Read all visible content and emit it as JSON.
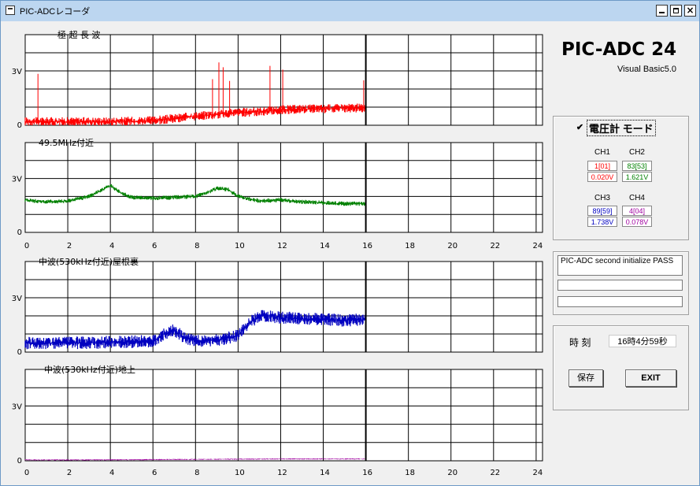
{
  "window": {
    "title": "PIC-ADCレコーダ"
  },
  "app": {
    "name": "PIC-ADC 24",
    "subtitle": "Visual Basic5.0"
  },
  "mode": {
    "label": "電圧計 モード",
    "checked": true,
    "check_glyph": "✔"
  },
  "channels": [
    {
      "label": "CH1",
      "raw": "1[01]",
      "voltage": "0.020V",
      "color": "#ff0000"
    },
    {
      "label": "CH2",
      "raw": "83[53]",
      "voltage": "1.621V",
      "color": "#008000"
    },
    {
      "label": "CH3",
      "raw": "89[59]",
      "voltage": "1.738V",
      "color": "#0000c0"
    },
    {
      "label": "CH4",
      "raw": "4[04]",
      "voltage": "0.078V",
      "color": "#a000a0"
    }
  ],
  "status_lines": [
    "PIC-ADC second initialize PASS",
    "",
    ""
  ],
  "clock": {
    "label": "時 刻",
    "value": "16時4分59秒"
  },
  "buttons": {
    "save": "保存",
    "exit": "EXIT"
  },
  "chart_data": [
    {
      "type": "line",
      "title": "極 超 長 波",
      "ytick_labels": [
        "3V",
        "0"
      ],
      "x_tick_labels": [],
      "xlim": [
        0,
        24.3
      ],
      "ylim": [
        0,
        5
      ],
      "cursor_x": 16,
      "color": "#ff0000",
      "series": [
        {
          "x": [
            0,
            2,
            4,
            6,
            8,
            9,
            10,
            11,
            12,
            13,
            14,
            15,
            16
          ],
          "values": [
            0.2,
            0.2,
            0.2,
            0.25,
            0.5,
            0.6,
            0.7,
            0.75,
            0.85,
            0.9,
            0.9,
            0.95,
            0.95
          ]
        }
      ]
    },
    {
      "type": "line",
      "title": "49.5MHz付近",
      "ytick_labels": [
        "3V",
        "0"
      ],
      "x_tick_labels": [
        "0",
        "2",
        "4",
        "6",
        "8",
        "10",
        "12",
        "14",
        "16",
        "18",
        "20",
        "22",
        "24"
      ],
      "xlim": [
        0,
        24.3
      ],
      "ylim": [
        0,
        5
      ],
      "cursor_x": 16,
      "color": "#008000",
      "series": [
        {
          "x": [
            0,
            1,
            2,
            3,
            3.5,
            4,
            4.5,
            5,
            6,
            7,
            8,
            8.5,
            9,
            9.5,
            10,
            11,
            12,
            13,
            14,
            15,
            16
          ],
          "values": [
            1.8,
            1.7,
            1.75,
            2.0,
            2.3,
            2.6,
            2.2,
            1.95,
            1.9,
            1.95,
            2.0,
            2.2,
            2.45,
            2.4,
            2.0,
            1.75,
            1.8,
            1.7,
            1.65,
            1.6,
            1.6
          ]
        }
      ]
    },
    {
      "type": "line",
      "title": "中波(530kHz付近)屋根裏",
      "ytick_labels": [
        "3V",
        "0"
      ],
      "x_tick_labels": [],
      "xlim": [
        0,
        24.3
      ],
      "ylim": [
        0,
        5
      ],
      "cursor_x": 16,
      "color": "#0000c0",
      "series": [
        {
          "x": [
            0,
            2,
            4,
            6,
            6.5,
            7,
            7.5,
            8,
            9,
            10,
            10.5,
            11,
            11.5,
            12,
            13,
            14,
            15,
            16
          ],
          "values": [
            0.5,
            0.5,
            0.55,
            0.6,
            1.0,
            1.2,
            0.8,
            0.6,
            0.65,
            0.9,
            1.6,
            2.0,
            2.0,
            1.9,
            1.85,
            1.8,
            1.75,
            1.8
          ]
        }
      ]
    },
    {
      "type": "line",
      "title": "中波(530kHz付近)地上",
      "ytick_labels": [
        "3V",
        "0"
      ],
      "x_tick_labels": [
        "0",
        "2",
        "4",
        "6",
        "8",
        "10",
        "12",
        "14",
        "16",
        "18",
        "20",
        "22",
        "24"
      ],
      "xlim": [
        0,
        24.3
      ],
      "ylim": [
        0,
        5
      ],
      "cursor_x": 16,
      "color": "#a000a0",
      "series": [
        {
          "x": [
            0,
            4,
            8,
            12,
            16
          ],
          "values": [
            0.05,
            0.05,
            0.08,
            0.1,
            0.1
          ]
        }
      ]
    }
  ]
}
